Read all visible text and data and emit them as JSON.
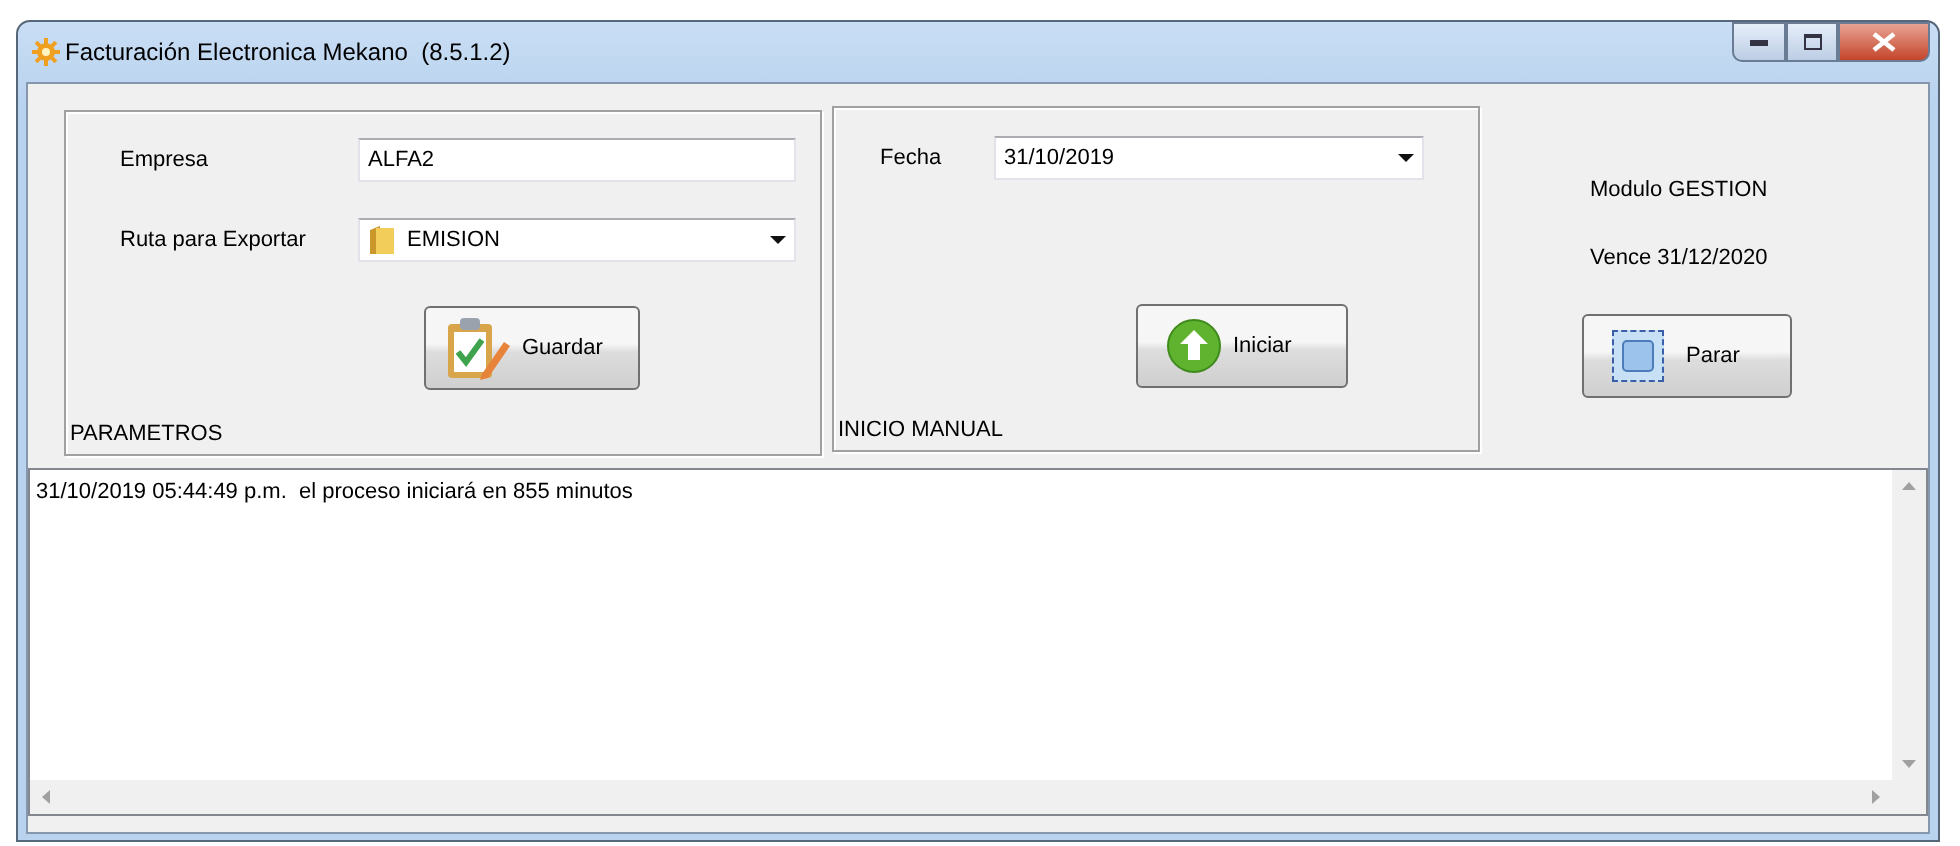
{
  "window": {
    "title": "Facturación Electronica Mekano  (8.5.1.2)"
  },
  "parametros": {
    "caption": "PARAMETROS",
    "fields": [
      {
        "label": "Empresa",
        "kind": "text",
        "value": "ALFA2"
      },
      {
        "label": "Ruta para Exportar",
        "kind": "folder-dropdown",
        "value": "EMISION"
      }
    ],
    "button": "Guardar"
  },
  "inicio_manual": {
    "caption": "INICIO MANUAL",
    "field": {
      "label": "Fecha",
      "kind": "date-dropdown",
      "value": "31/10/2019"
    },
    "button": "Iniciar"
  },
  "module": {
    "name": "Modulo GESTION",
    "expires": "Vence 31/12/2020",
    "button": {
      "label": "Parar",
      "focused": true
    }
  },
  "log": {
    "lines": [
      "31/10/2019 05:44:49 p.m.  el proceso iniciará en 855 minutos"
    ]
  }
}
